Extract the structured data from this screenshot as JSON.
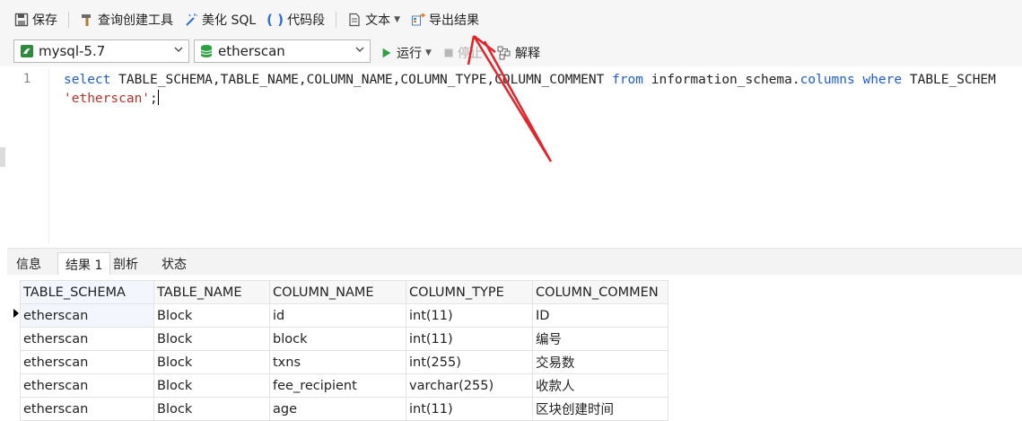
{
  "toolbar": {
    "save": "保存",
    "query_builder": "查询创建工具",
    "beautify": "美化 SQL",
    "snippet": "代码段",
    "text": "文本",
    "export": "导出结果"
  },
  "toolbar2": {
    "connection": "mysql-5.7",
    "database": "etherscan",
    "run": "运行",
    "stop": "停止",
    "explain": "解释"
  },
  "editor": {
    "line_number": "1",
    "line1_kw1": "select",
    "line1_cols": " TABLE_SCHEMA,TABLE_NAME,COLUMN_NAME,COLUMN_TYPE,COLUMN_COMMENT ",
    "line1_kw2": "from",
    "line1_tbl": " information_schema.",
    "line1_kw3": "columns",
    "line1_sp": " ",
    "line1_kw4": "where",
    "line1_rest": " TABLE_SCHEM",
    "line2_str": "'etherscan'",
    "line2_end": ";"
  },
  "result_tabs": [
    "信息",
    "结果 1",
    "剖析",
    "状态"
  ],
  "result_grid": {
    "columns": [
      "TABLE_SCHEMA",
      "TABLE_NAME",
      "COLUMN_NAME",
      "COLUMN_TYPE",
      "COLUMN_COMMEN"
    ],
    "rows": [
      [
        "etherscan",
        "Block",
        "id",
        "int(11)",
        "ID"
      ],
      [
        "etherscan",
        "Block",
        "block",
        "int(11)",
        "编号"
      ],
      [
        "etherscan",
        "Block",
        "txns",
        "int(255)",
        "交易数"
      ],
      [
        "etherscan",
        "Block",
        "fee_recipient",
        "varchar(255)",
        "收款人"
      ],
      [
        "etherscan",
        "Block",
        "age",
        "int(11)",
        "区块创建时间"
      ]
    ]
  },
  "colors": {
    "keyword": "#1f5bd6",
    "string": "#b5342f",
    "annotation": "#e0262a"
  },
  "icons": [
    "save-icon",
    "hammer-icon",
    "magic-wand-icon",
    "braces-icon",
    "document-icon",
    "export-icon",
    "dolphin-icon",
    "database-icon",
    "play-icon",
    "stop-icon",
    "explain-icon"
  ]
}
